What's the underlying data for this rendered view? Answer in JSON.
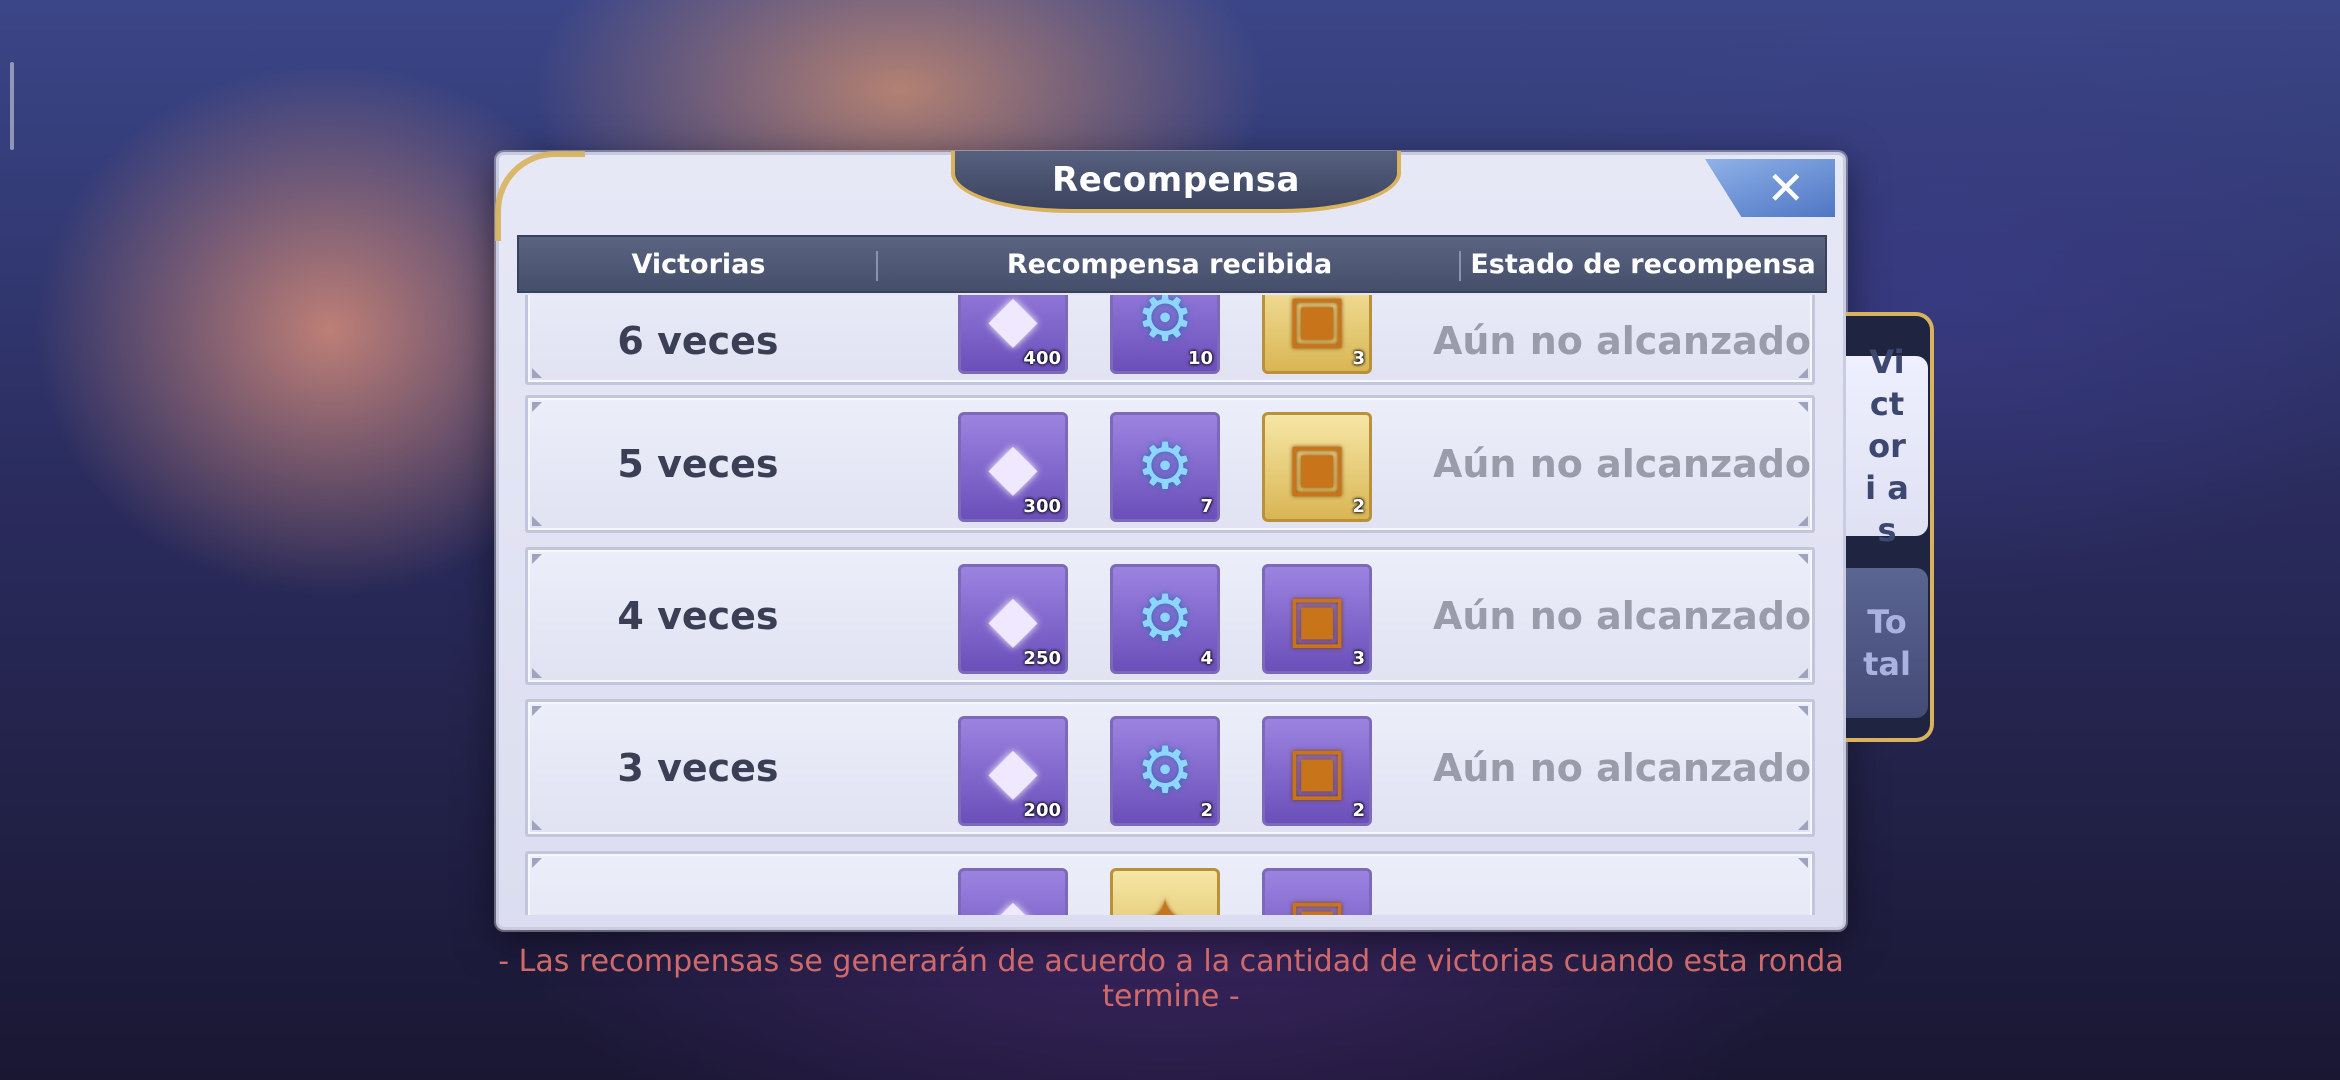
{
  "title": "Recompensa",
  "close_icon": "close-x-icon",
  "header": {
    "col_victories": "Victorias",
    "col_reward": "Recompensa recibida",
    "col_state": "Estado de recompensa"
  },
  "rows": [
    {
      "victories": "6 veces",
      "items": [
        {
          "icon": "gem-icon",
          "qty": "400"
        },
        {
          "icon": "gear-icon",
          "qty": "10"
        },
        {
          "icon": "chest-icon",
          "qty": "3"
        }
      ],
      "state": "Aún no alcanzado"
    },
    {
      "victories": "5 veces",
      "items": [
        {
          "icon": "gem-icon",
          "qty": "300"
        },
        {
          "icon": "gear-icon",
          "qty": "7"
        },
        {
          "icon": "chest-icon",
          "qty": "2"
        }
      ],
      "state": "Aún no alcanzado"
    },
    {
      "victories": "4 veces",
      "items": [
        {
          "icon": "gem-icon",
          "qty": "250"
        },
        {
          "icon": "gear-icon",
          "qty": "4"
        },
        {
          "icon": "chest-icon",
          "qty": "3"
        }
      ],
      "state": "Aún no alcanzado"
    },
    {
      "victories": "3 veces",
      "items": [
        {
          "icon": "gem-icon",
          "qty": "200"
        },
        {
          "icon": "gear-icon",
          "qty": "2"
        },
        {
          "icon": "chest-icon",
          "qty": "2"
        }
      ],
      "state": "Aún no alcanzado"
    },
    {
      "victories": "",
      "items": [
        {
          "icon": "gem-icon",
          "qty": ""
        },
        {
          "icon": "gold-item-icon",
          "qty": ""
        },
        {
          "icon": "chest-icon",
          "qty": ""
        }
      ],
      "state": ""
    }
  ],
  "footer_note": "- Las recompensas se generarán de acuerdo a la cantidad de victorias cuando esta ronda termine -",
  "side_tabs": {
    "victories": "Vi ct ori as",
    "total": "To tal"
  },
  "colors": {
    "accent_gold": "#d8b25c",
    "header_bg": "#4f5875",
    "note_red": "#d06a6a",
    "state_gray": "#9a9cab"
  }
}
